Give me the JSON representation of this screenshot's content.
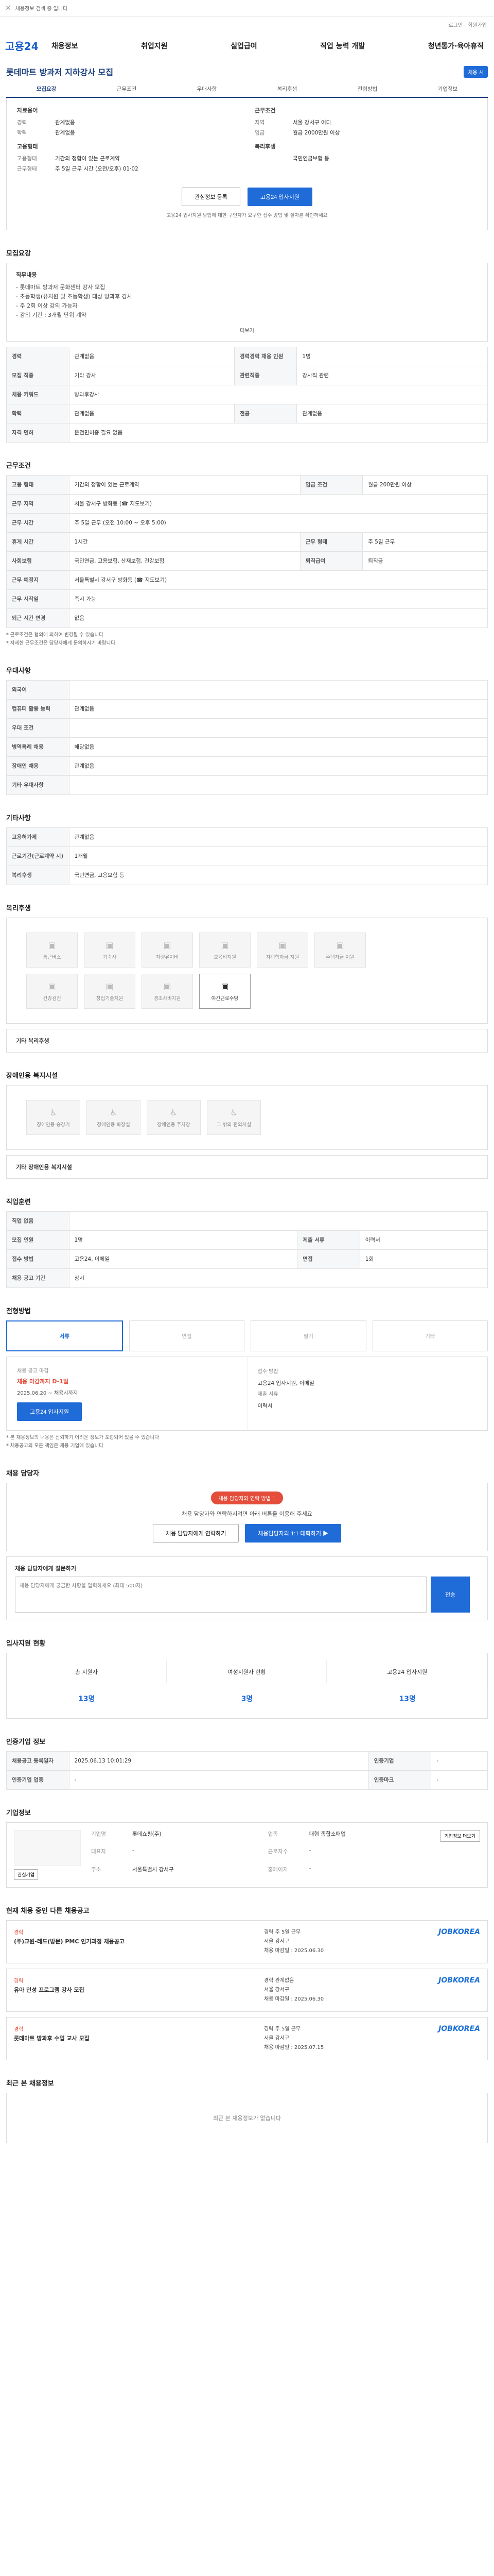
{
  "topbar": {
    "note": "채용정보 검색 중 입니다"
  },
  "utilbar": {
    "login": "로그인",
    "join": "회원가입"
  },
  "gnb": {
    "logo": "고용24",
    "menus": [
      "채용정보",
      "취업지원",
      "실업급여",
      "직업 능력 개발",
      "청년통가·육아휴직"
    ]
  },
  "title": {
    "text": "롯데마트 방과저 지하강사 모집",
    "badge": "채용 시"
  },
  "tabs": [
    "모집요강",
    "근무조건",
    "우대사항",
    "복리후생",
    "전형방법",
    "기업정보"
  ],
  "summary": {
    "g1": "자료용어",
    "r1": [
      [
        "경력",
        "관계없음"
      ],
      [
        "학력",
        "관계없음"
      ]
    ],
    "g2": "근무조건",
    "r2": [
      [
        "지역",
        "서울 강서구 어디"
      ],
      [
        "임금",
        "월급 2000만원 이상"
      ]
    ],
    "g3": "고용형태",
    "r3": [
      [
        "고용형태",
        "기간의 정함이 있는 근로계약"
      ],
      [
        "근무형태",
        "주 5일 근무 시간 (오전/오후) 01·02"
      ]
    ],
    "g4": "복리후생",
    "r4": [
      [
        "",
        "국민연금보험 등"
      ]
    ]
  },
  "actions": {
    "scrap": "관심정보 등록",
    "apply": "고용24 입사지원"
  },
  "hint": "고용24 입사지원 방법에 대한 구인자가 요구한 접수 방법 및 절차를 확인하세요",
  "rec": {
    "heading": "모집요강",
    "box_title": "직무내용",
    "lines": [
      "- 롯데마트 방과저 문화센터 강사 모집",
      "- 초등학생(유치원 및 초등학생) 대상 방과후 강사",
      "- 주 2회 이상 강의 가능자",
      "- 강의 기간 : 3개월 단위 계약"
    ],
    "more": "더보기"
  },
  "rows": {
    "r1": [
      "경력",
      "관계없음",
      "경력경력 채용 인원",
      "1명"
    ],
    "r2": [
      "모집 직종",
      "기타 강사",
      "관련직종",
      "강사직 관련"
    ],
    "r3": [
      "채용 키워드",
      "방과후강사",
      ""
    ],
    "r4": [
      "학력",
      "관계없음",
      "전공",
      "관계없음"
    ],
    "r5": [
      "자격 면허",
      "운전면허증 필요 없음",
      ""
    ]
  },
  "work": {
    "heading": "근무조건",
    "rows": [
      [
        "고용 형태",
        "기간의 정함이 있는 근로계약",
        "임금 조건",
        "월급 200만원 이상"
      ],
      [
        "근무 지역",
        "서울 강서구 방화동 (☎ 지도보기)",
        "",
        ""
      ],
      [
        "근무 시간",
        "주 5일 근무 (오전 10:00 ~ 오후 5:00)",
        "",
        ""
      ],
      [
        "휴게 시간",
        "1시간",
        "근무 형태",
        "주 5일 근무"
      ],
      [
        "사회보험",
        "국민연금, 고용보험, 산재보험, 건강보험",
        "퇴직급여",
        "퇴직금"
      ],
      [
        "근무 예정지",
        "서울특별시 강서구 방화동 (☎ 지도보기)",
        "",
        ""
      ],
      [
        "근무 시작일",
        "즉시 가능",
        "",
        ""
      ],
      [
        "퇴근 시간 변경",
        "없음",
        "",
        ""
      ]
    ],
    "notes": [
      "* 근로조건은 협의에 의하여 변경될 수 있습니다",
      "* 자세한 근무조건은 담당자에게 문의하시기 바랍니다"
    ]
  },
  "pref": {
    "heading": "우대사항",
    "rows": [
      [
        "외국어",
        ""
      ],
      [
        "컴퓨터 활용 능력",
        "관계없음"
      ],
      [
        "우대 조건",
        ""
      ],
      [
        "병역특례 채용",
        "해당없음"
      ],
      [
        "장애인 채용",
        "관계없음"
      ],
      [
        "기타 우대사항",
        ""
      ]
    ]
  },
  "etc": {
    "heading": "기타사항",
    "rows": [
      [
        "고용허가제",
        "관계없음"
      ],
      [
        "근로기간(근로계약 시)",
        "1개월"
      ],
      [
        "복리후생",
        "국민연금, 고용보험 등"
      ]
    ]
  },
  "welfare": {
    "heading": "복리후생",
    "items": [
      "통근버스",
      "기숙사",
      "차량유지비",
      "교육비지원",
      "자녀학자금 지원",
      "주택자금 지원",
      "건강검진",
      "창업기술지원",
      "경조사비지원",
      "야간근로수당"
    ],
    "note": "기타 복리후생",
    "note_val": ""
  },
  "disab": {
    "heading": "장애인용 복지시설",
    "items": [
      "장애인용 승강기",
      "장애인용 화장실",
      "장애인용 주차장",
      "그 밖의 편의시설"
    ],
    "note": "기타 장애인용 복지시설",
    "note_val": ""
  },
  "recruit": {
    "heading": "직업훈련",
    "rows": [
      [
        "직업 없음",
        ""
      ],
      [
        "모집 인원",
        "1명",
        "제출 서류",
        "이력서"
      ],
      [
        "접수 방법",
        "고용24, 이메일",
        "면접",
        "1회"
      ],
      [
        "채용 공고 기간",
        "상시",
        "",
        ""
      ]
    ]
  },
  "screen": {
    "heading": "전형방법",
    "steps": [
      "서류",
      "면접",
      "필기",
      "기타"
    ]
  },
  "apply": {
    "head1": "채용 공고 마감",
    "deadline": "채용 마감까지 D-1일",
    "date": "2025.06.20 ~ 채용시까지",
    "btn": "고용24 입사지원",
    "head2": "접수 방법",
    "method": "고용24 입사지원, 이메일",
    "lbl3": "제출 서류",
    "docs": "이력서"
  },
  "notices": [
    "* 본 채용정보의 내용은 신뢰하기 어려운 정보가 포함되어 있을 수 있습니다",
    "* 채용공고의 모든 책임은 채용 기업에 있습니다"
  ],
  "safe": {
    "heading": "채용 담당자",
    "pill": "채용 담당자와 연락 방법 1",
    "desc": "채용 담당자와 연락하시려면 아래 버튼을 이용해 주세요",
    "b1": "채용 담당자에게 연락하기",
    "b2": "채용담당자와 1:1 대화하기 ▶"
  },
  "q": {
    "heading": "채용 담당자에게 질문하기",
    "placeholder": "채용 담당자에게 궁금한 사항을 입력하세요 (최대 500자)",
    "send": "전송"
  },
  "stats": {
    "heading": "입사지원 현황",
    "items": [
      [
        "총 지원자",
        "13명"
      ],
      [
        "여성지원자 현황",
        "3명"
      ],
      [
        "고용24 입사지원",
        "13명"
      ]
    ]
  },
  "info": {
    "heading": "인증기업 정보",
    "rows": [
      [
        "채용공고 등록일자",
        "2025.06.13 10:01:29",
        "인증기업",
        "-"
      ],
      [
        "인증기업 업종",
        "-",
        "인증마크",
        "-"
      ]
    ]
  },
  "company": {
    "heading": "기업정보",
    "rows": [
      [
        "기업명",
        "롯데쇼핑(주)",
        "업종",
        "대형 종합소매업"
      ],
      [
        "대표자",
        "-",
        "근로자수",
        "-"
      ],
      [
        "주소",
        "서울특별시 강서구",
        "홈페이지",
        "-"
      ]
    ],
    "b1": "관심기업",
    "b2": "기업정보 더보기"
  },
  "jobs": {
    "heading": "현재 채용 중인 다른 채용공고",
    "list": [
      {
        "tag": "경력",
        "name": "(주)교원-레드(방문) PMC 인기과정 채용공고",
        "meta": [
          "경력  주 5일 근무",
          "서울 강서구",
          "채용 마감일 : 2025.06.30"
        ],
        "co": "JOBKOREA"
      },
      {
        "tag": "경력",
        "name": "유아 인성 프로그램 강사 모집",
        "meta": [
          "경력  관계없음",
          "서울 강서구",
          "채용 마감일 : 2025.06.30"
        ],
        "co": "JOBKOREA"
      },
      {
        "tag": "경력",
        "name": "롯데마트 방과후 수업 교사 모집",
        "meta": [
          "경력  주 5일 근무",
          "서울 강서구",
          "채용 마감일 : 2025.07.15"
        ],
        "co": "JOBKOREA"
      }
    ]
  },
  "recent": {
    "heading": "최근 본 채용정보",
    "empty": "최근 본 채용정보가 없습니다"
  }
}
